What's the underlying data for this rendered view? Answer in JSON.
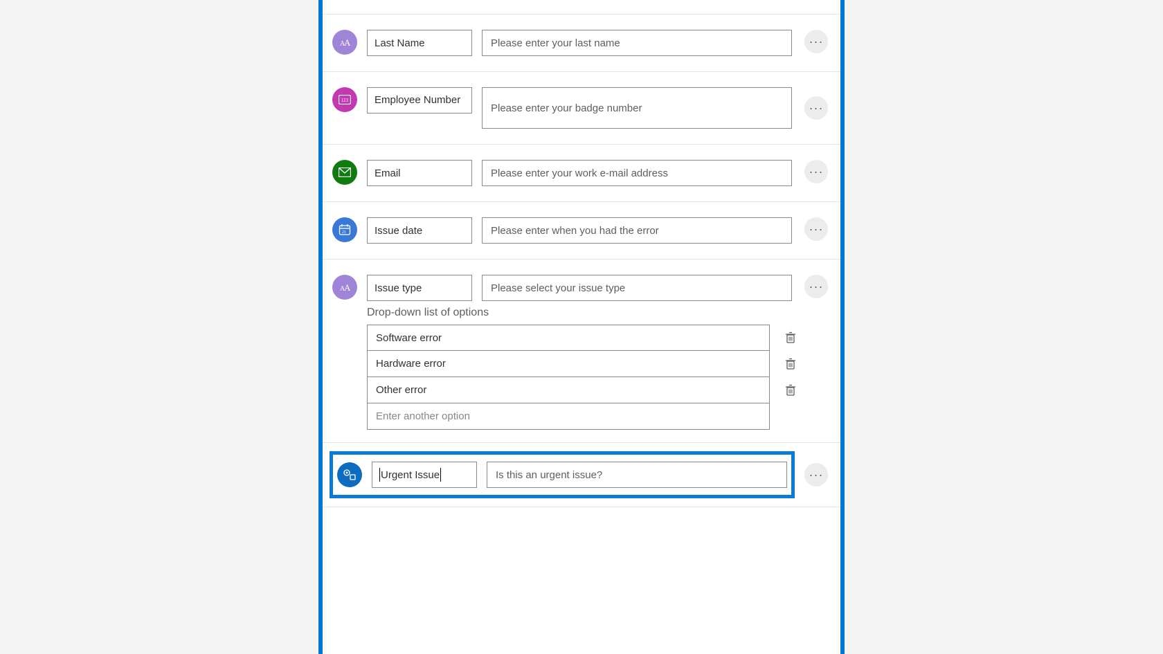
{
  "rows": [
    {
      "label": "Last Name",
      "placeholder": "Please enter your last name",
      "icon": "text"
    },
    {
      "label": "Employee Number",
      "placeholder": "Please enter your badge number",
      "icon": "number"
    },
    {
      "label": "Email",
      "placeholder": "Please enter your work e-mail address",
      "icon": "email"
    },
    {
      "label": "Issue date",
      "placeholder": "Please enter when you had the error",
      "icon": "date"
    },
    {
      "label": "Issue type",
      "placeholder": "Please select your issue type",
      "icon": "text"
    }
  ],
  "dropdown": {
    "title": "Drop-down list of options",
    "options": [
      "Software error",
      "Hardware error",
      "Other error"
    ],
    "new_option_placeholder": "Enter another option"
  },
  "selected": {
    "label": "Urgent Issue",
    "placeholder": "Is this an urgent issue?",
    "icon": "boolean"
  },
  "glyphs": {
    "more": "···"
  }
}
